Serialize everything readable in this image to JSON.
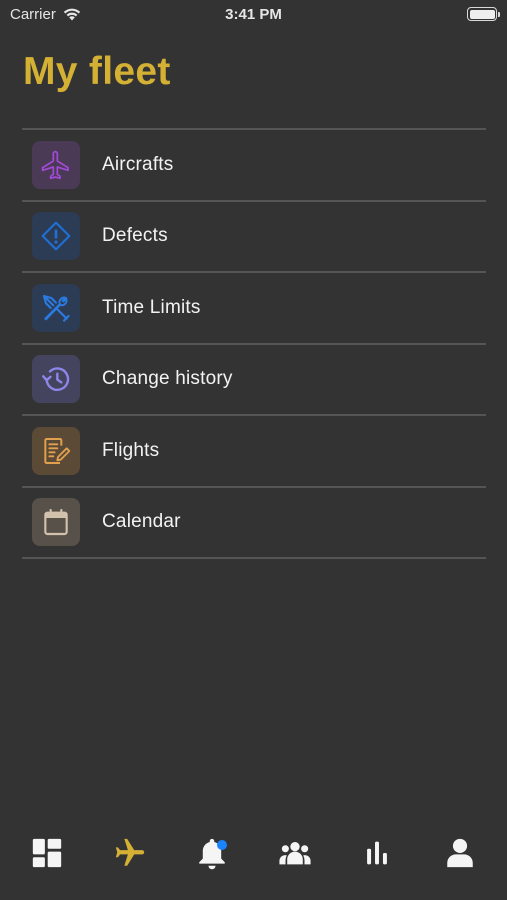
{
  "status_bar": {
    "carrier": "Carrier",
    "time": "3:41 PM"
  },
  "page": {
    "title": "My fleet"
  },
  "menu": {
    "items": [
      {
        "label": "Aircrafts",
        "icon": "airplane-icon",
        "color": "#a04ad6",
        "tile": "#4a3a55"
      },
      {
        "label": "Defects",
        "icon": "diamond-alert-icon",
        "color": "#1f6fd6",
        "tile": "#2c3c55"
      },
      {
        "label": "Time Limits",
        "icon": "tools-icon",
        "color": "#2a7ae0",
        "tile": "#2c3c55"
      },
      {
        "label": "Change history",
        "icon": "history-icon",
        "color": "#8d86e8",
        "tile": "#44445e"
      },
      {
        "label": "Flights",
        "icon": "notes-icon",
        "color": "#e0a050",
        "tile": "#5b4a35"
      },
      {
        "label": "Calendar",
        "icon": "calendar-icon",
        "color": "#d2c2ad",
        "tile": "#58514a"
      }
    ]
  },
  "tab_bar": {
    "active_color": "#d4b035",
    "inactive_color": "#f5f5f5",
    "tabs": [
      {
        "icon": "dashboard-icon",
        "active": false
      },
      {
        "icon": "airplane-icon",
        "active": true
      },
      {
        "icon": "bell-icon",
        "active": false,
        "badge": true
      },
      {
        "icon": "people-icon",
        "active": false
      },
      {
        "icon": "bar-chart-icon",
        "active": false
      },
      {
        "icon": "user-icon",
        "active": false
      }
    ]
  }
}
